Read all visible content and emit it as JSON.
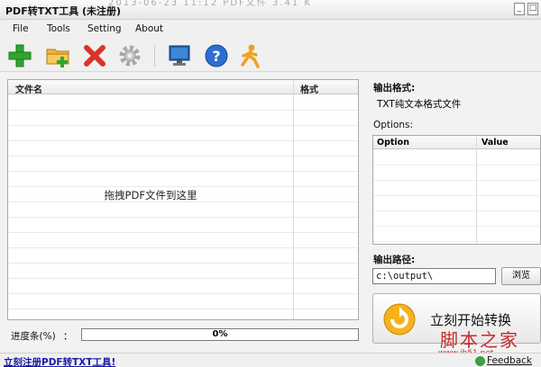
{
  "window": {
    "title": "PDF转TXT工具 (未注册)",
    "ghost_text": "2013-06-23 11:12    PDF文件    3.41 K"
  },
  "menu": {
    "items": [
      "File",
      "Tools",
      "Setting",
      "About"
    ]
  },
  "toolbar": {
    "buttons": [
      {
        "name": "add",
        "icon": "plus-icon",
        "color": "#2fa52f"
      },
      {
        "name": "add-folder",
        "icon": "folder-add-icon",
        "color": "#e8a317"
      },
      {
        "name": "remove",
        "icon": "close-icon",
        "color": "#d8342a"
      },
      {
        "name": "settings",
        "icon": "gear-icon",
        "color": "#9a9a9a"
      },
      {
        "name": "screen",
        "icon": "monitor-icon",
        "color": "#1e5fb0"
      },
      {
        "name": "help",
        "icon": "help-icon",
        "color": "#2a6fd1"
      },
      {
        "name": "run",
        "icon": "runner-icon",
        "color": "#f0a020"
      }
    ]
  },
  "filelist": {
    "col_filename": "文件名",
    "col_format": "格式",
    "drop_hint": "拖拽PDF文件到这里"
  },
  "progress": {
    "label": "进度条(%)",
    "colon": "：",
    "value": 0,
    "text": "0%"
  },
  "right_panel": {
    "output_format_label": "输出格式:",
    "output_format_value": "TXT纯文本格式文件",
    "options_label": "Options:",
    "options_col_option": "Option",
    "options_col_value": "Value",
    "output_path_label": "输出路径:",
    "output_path_value": "c:\\output\\",
    "browse_label": "浏览",
    "start_label": "立刻开始转换"
  },
  "watermark": {
    "text": "脚本之家",
    "url": "www.jb51.net"
  },
  "statusbar": {
    "register_link": "立刻注册PDF转TXT工具!",
    "feedback": "Feedback"
  }
}
